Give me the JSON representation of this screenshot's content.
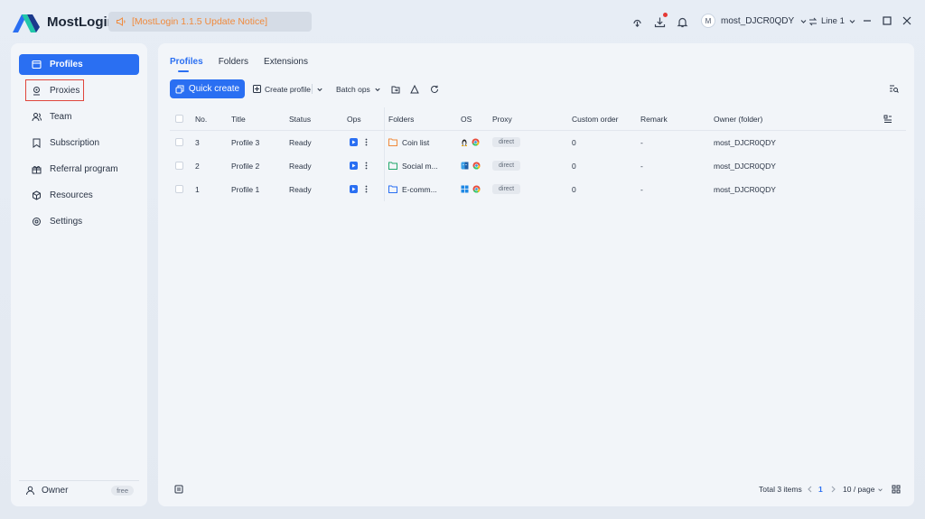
{
  "app": {
    "name": "MostLogin",
    "notice": "[MostLogin 1.1.5 Update Notice]"
  },
  "topbar": {
    "username": "most_DJCR0QDY",
    "avatar_initial": "M",
    "line": "Line 1"
  },
  "sidebar": {
    "items": [
      {
        "label": "Profiles",
        "icon": "window-icon"
      },
      {
        "label": "Proxies",
        "icon": "proxy-icon"
      },
      {
        "label": "Team",
        "icon": "team-icon"
      },
      {
        "label": "Subscription",
        "icon": "bookmark-icon"
      },
      {
        "label": "Referral program",
        "icon": "gift-icon"
      },
      {
        "label": "Resources",
        "icon": "cube-icon"
      },
      {
        "label": "Settings",
        "icon": "gear-icon"
      }
    ],
    "footer": {
      "label": "Owner",
      "badge": "free"
    }
  },
  "main": {
    "tabs": [
      "Profiles",
      "Folders",
      "Extensions"
    ],
    "toolbar": {
      "quick_create": "Quick create",
      "create_profile": "Create profile",
      "batch_ops": "Batch ops"
    },
    "table": {
      "columns": [
        "No.",
        "Title",
        "Status",
        "Ops",
        "Folders",
        "OS",
        "Proxy",
        "Custom order",
        "Remark",
        "Owner (folder)"
      ],
      "rows": [
        {
          "no": "3",
          "title": "Profile 3",
          "status": "Ready",
          "folder": "Coin list",
          "folder_color": "#f08a3c",
          "os": "linux",
          "proxy": "direct",
          "order": "0",
          "remark": "-",
          "owner": "most_DJCR0QDY"
        },
        {
          "no": "2",
          "title": "Profile 2",
          "status": "Ready",
          "folder": "Social m...",
          "folder_color": "#22a86b",
          "os": "macos",
          "proxy": "direct",
          "order": "0",
          "remark": "-",
          "owner": "most_DJCR0QDY"
        },
        {
          "no": "1",
          "title": "Profile 1",
          "status": "Ready",
          "folder": "E-comm...",
          "folder_color": "#2a6ff2",
          "os": "windows",
          "proxy": "direct",
          "order": "0",
          "remark": "-",
          "owner": "most_DJCR0QDY"
        }
      ]
    },
    "footer": {
      "total": "Total 3 items",
      "page": "1",
      "per_page": "10 / page"
    }
  },
  "colors": {
    "accent": "#2a6ff2",
    "notice": "#f08a3c",
    "highlight": "#e0463c"
  }
}
